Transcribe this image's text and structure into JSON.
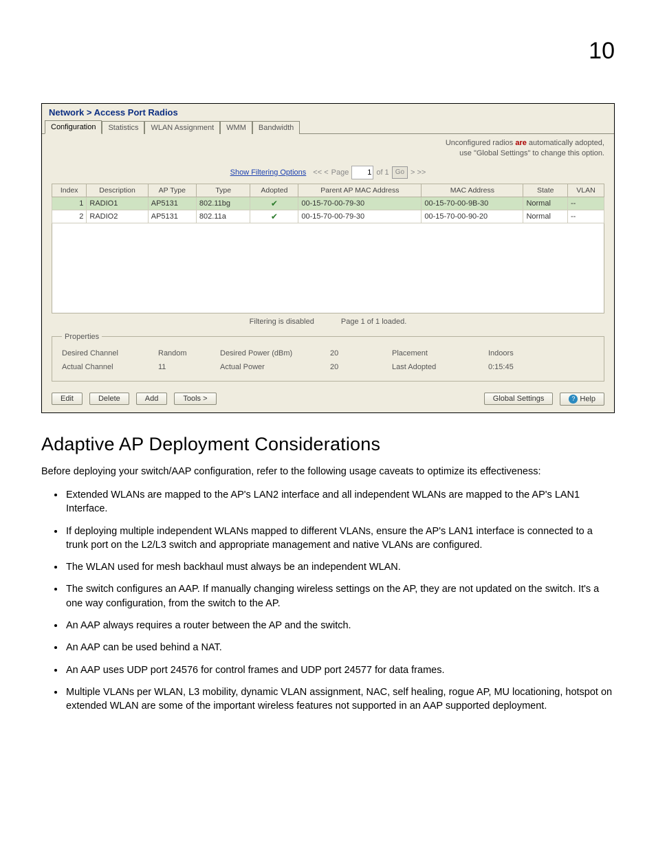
{
  "chapter_number": "10",
  "figure": {
    "breadcrumb": "Network > Access Port Radios",
    "tabs": [
      "Configuration",
      "Statistics",
      "WLAN Assignment",
      "WMM",
      "Bandwidth"
    ],
    "notice_pre": "Unconfigured radios ",
    "notice_are": "are",
    "notice_post": " automatically adopted,",
    "notice_line2": "use \"Global Settings\" to change this option.",
    "show_filter": "Show Filtering Options",
    "pager_prev": "<< <",
    "pager_page_label": "Page",
    "pager_page_value": "1",
    "pager_of": "of 1",
    "pager_go": "Go",
    "pager_next": "> >>",
    "headers": [
      "Index",
      "Description",
      "AP Type",
      "Type",
      "Adopted",
      "Parent AP MAC Address",
      "MAC Address",
      "State",
      "VLAN"
    ],
    "rows": [
      {
        "index": "1",
        "desc": "RADIO1",
        "aptype": "AP5131",
        "type": "802.11bg",
        "adopted": "✔",
        "parent": "00-15-70-00-79-30",
        "mac": "00-15-70-00-9B-30",
        "state": "Normal",
        "vlan": "--"
      },
      {
        "index": "2",
        "desc": "RADIO2",
        "aptype": "AP5131",
        "type": "802.11a",
        "adopted": "✔",
        "parent": "00-15-70-00-79-30",
        "mac": "00-15-70-00-90-20",
        "state": "Normal",
        "vlan": "--"
      }
    ],
    "status_filter": "Filtering is disabled",
    "status_page": "Page 1 of 1 loaded.",
    "props_legend": "Properties",
    "props": {
      "desired_channel_l": "Desired Channel",
      "desired_channel_v": "Random",
      "desired_power_l": "Desired Power (dBm)",
      "desired_power_v": "20",
      "placement_l": "Placement",
      "placement_v": "Indoors",
      "actual_channel_l": "Actual Channel",
      "actual_channel_v": "11",
      "actual_power_l": "Actual Power",
      "actual_power_v": "20",
      "last_adopted_l": "Last Adopted",
      "last_adopted_v": "0:15:45"
    },
    "buttons": {
      "edit": "Edit",
      "delete": "Delete",
      "add": "Add",
      "tools": "Tools >",
      "global": "Global Settings",
      "help": "Help"
    }
  },
  "section_title": "Adaptive AP Deployment Considerations",
  "lead": "Before deploying your switch/AAP configuration, refer to the following usage caveats to optimize its effectiveness:",
  "bullets": [
    "Extended WLANs are mapped to the AP's LAN2 interface and all independent WLANs are mapped to the AP's LAN1 Interface.",
    "If deploying multiple independent WLANs mapped to different VLANs, ensure the AP's LAN1 interface is connected to a trunk port on the L2/L3 switch and appropriate management and native VLANs are configured.",
    "The WLAN used for mesh backhaul must always be an independent WLAN.",
    "The switch configures an AAP. If manually changing wireless settings on the AP, they are not updated on the switch. It's a one way configuration, from the switch to the AP.",
    "An AAP always requires a router between the AP and the switch.",
    "An AAP can be used behind a NAT.",
    "An AAP uses UDP port 24576 for control frames and UDP port 24577 for data frames.",
    "Multiple VLANs per WLAN, L3 mobility, dynamic VLAN assignment, NAC, self healing, rogue AP, MU locationing, hotspot on extended WLAN are some of the important wireless features not supported in an AAP supported deployment."
  ]
}
